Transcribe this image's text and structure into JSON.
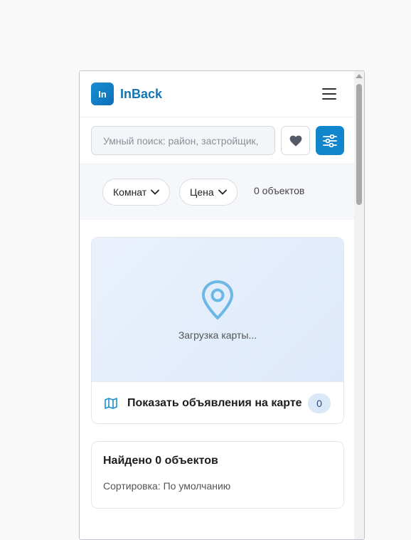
{
  "header": {
    "logo_text": "In",
    "brand": "InBack"
  },
  "search": {
    "placeholder": "Умный поиск: район, застройщик,"
  },
  "filters": {
    "rooms_label": "Комнат",
    "price_label": "Цена",
    "count_label": "0 объектов"
  },
  "map": {
    "loading_text": "Загрузка карты...",
    "show_on_map_label": "Показать объявления на карте",
    "show_on_map_count": "0"
  },
  "results": {
    "title": "Найдено 0 объектов",
    "sort_label": "Сортировка: По умолчанию"
  },
  "colors": {
    "accent": "#1186cc",
    "brand": "#1277b8",
    "pin": "#6bb8e6"
  },
  "icons": [
    "hamburger-menu-icon",
    "heart-icon",
    "sliders-icon",
    "chevron-down-icon",
    "map-pin-icon",
    "map-icon"
  ]
}
